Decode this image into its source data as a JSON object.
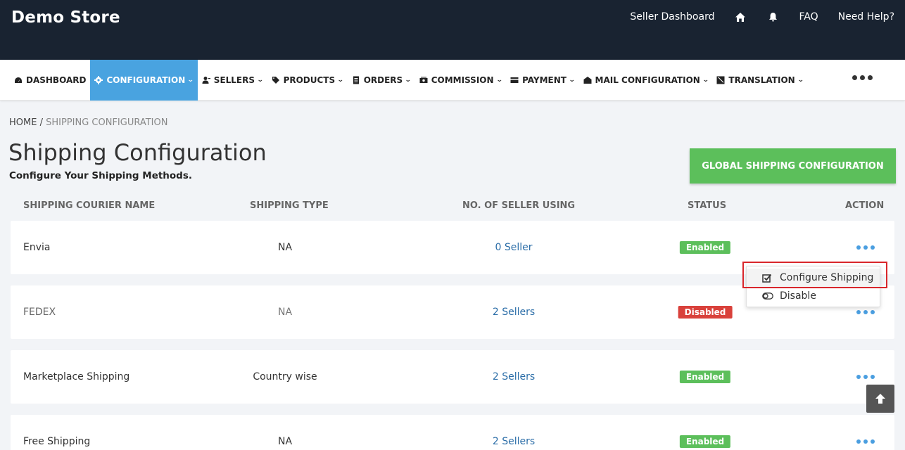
{
  "header": {
    "brand": "Demo Store",
    "links": {
      "seller_dashboard": "Seller Dashboard",
      "faq": "FAQ",
      "need_help": "Need Help?"
    }
  },
  "nav": {
    "items": [
      {
        "label": "DASHBOARD",
        "icon": "dashboard-icon"
      },
      {
        "label": "CONFIGURATION",
        "icon": "gear-icon",
        "active": true
      },
      {
        "label": "SELLERS",
        "icon": "users-icon"
      },
      {
        "label": "PRODUCTS",
        "icon": "tag-icon"
      },
      {
        "label": "ORDERS",
        "icon": "list-icon"
      },
      {
        "label": "COMMISSION",
        "icon": "money-icon"
      },
      {
        "label": "PAYMENT",
        "icon": "card-icon"
      },
      {
        "label": "MAIL CONFIGURATION",
        "icon": "envelope-icon"
      },
      {
        "label": "TRANSLATION",
        "icon": "translate-icon"
      }
    ],
    "active_color": "#49a3e0"
  },
  "breadcrumb": {
    "home": "HOME",
    "separator": " / ",
    "current": "SHIPPING CONFIGURATION"
  },
  "page": {
    "title": "Shipping Configuration",
    "subtitle": "Configure Your Shipping Methods.",
    "global_button": "GLOBAL SHIPPING CONFIGURATION"
  },
  "table": {
    "headers": {
      "name": "SHIPPING COURIER NAME",
      "type": "SHIPPING TYPE",
      "sellers": "NO. OF SELLER USING",
      "status": "STATUS",
      "action": "ACTION"
    },
    "rows": [
      {
        "name": "Envia",
        "type": "NA",
        "sellers": "0 Seller",
        "status": "Enabled"
      },
      {
        "name": "FEDEX",
        "type": "NA",
        "sellers": "2 Sellers",
        "status": "Disabled"
      },
      {
        "name": "Marketplace Shipping",
        "type": "Country wise",
        "sellers": "2 Sellers",
        "status": "Enabled"
      },
      {
        "name": "Free Shipping",
        "type": "NA",
        "sellers": "2 Sellers",
        "status": "Enabled"
      }
    ]
  },
  "dropdown": {
    "configure": "Configure Shipping",
    "disable": "Disable"
  },
  "colors": {
    "topbar": "#192331",
    "enabled": "#5cbf5b",
    "disabled": "#d9413b",
    "link": "#2c6ea8",
    "highlight": "#d9262b"
  }
}
